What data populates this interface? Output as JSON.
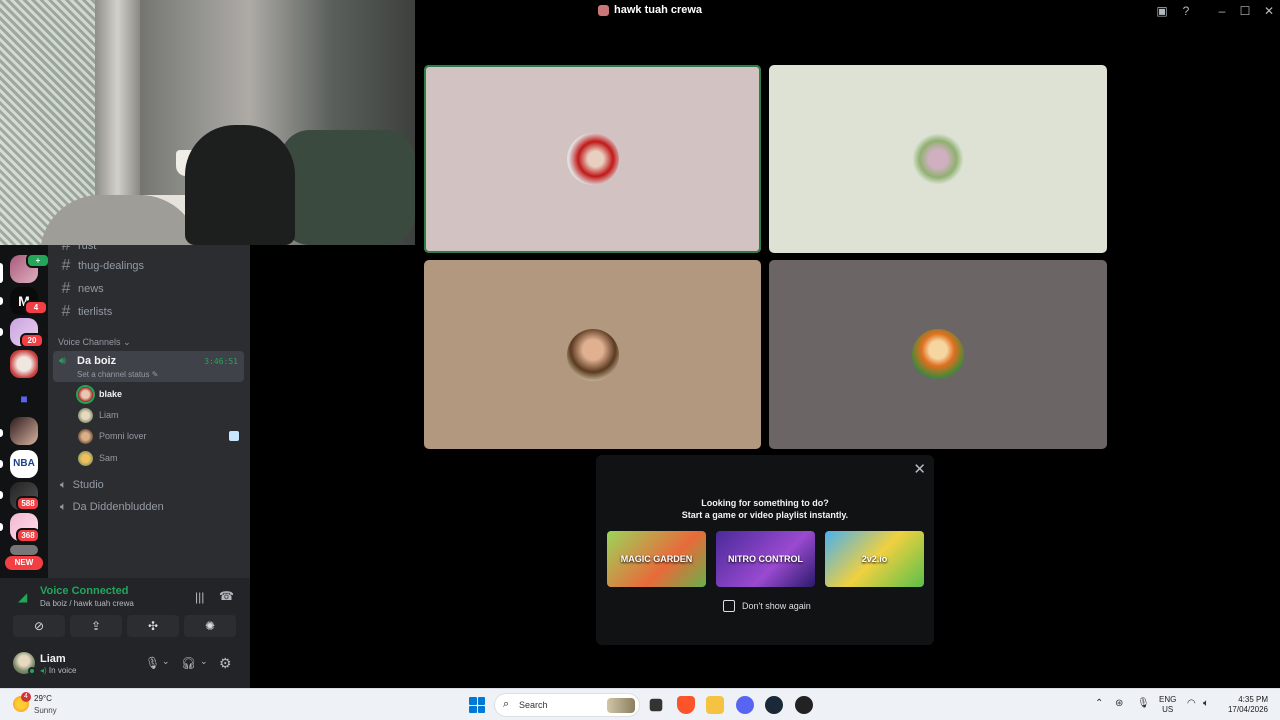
{
  "window": {
    "title": "hawk tuah crewa"
  },
  "servers": [
    {
      "name": "server-1",
      "badge": ""
    },
    {
      "name": "server-2",
      "badge": "4"
    },
    {
      "name": "server-3",
      "badge": "20"
    },
    {
      "name": "server-4",
      "badge": ""
    },
    {
      "name": "folder",
      "badge": ""
    },
    {
      "name": "server-6",
      "badge": ""
    },
    {
      "name": "nba",
      "badge": "NBA"
    },
    {
      "name": "server-8",
      "badge": "588"
    },
    {
      "name": "server-9",
      "badge": "368"
    }
  ],
  "new_badge": "NEW",
  "text_channels": [
    "rust",
    "thug-dealings",
    "news",
    "tierlists"
  ],
  "voice_section_label": "Voice Channels",
  "active_voice": {
    "name": "Da boiz",
    "timer": "3:46:51",
    "status_placeholder": "Set a channel status"
  },
  "members": [
    {
      "name": "blake",
      "speaking": true
    },
    {
      "name": "Liam",
      "speaking": false
    },
    {
      "name": "Pomni lover",
      "speaking": false
    },
    {
      "name": "Sam",
      "speaking": false
    }
  ],
  "other_voice": [
    "Studio",
    "Da Diddenbludden"
  ],
  "voice_panel": {
    "status": "Voice Connected",
    "location": "Da boiz / hawk tuah crewa"
  },
  "user": {
    "name": "Liam",
    "status": "In voice"
  },
  "popup": {
    "line1": "Looking for something to do?",
    "line2": "Start a game or video playlist instantly.",
    "activities": [
      "MAGIC GARDEN",
      "NITRO CONTROL",
      "2v2.io"
    ],
    "checkbox_label": "Don't show again"
  },
  "taskbar": {
    "temp": "29°C",
    "condition": "Sunny",
    "weather_badge": "4",
    "search_placeholder": "Search",
    "lang_top": "ENG",
    "lang_bottom": "US",
    "time": "4:35 PM",
    "date": "17/04/2026"
  },
  "colors": {
    "green": "#23a55a",
    "tile1": "#d2c2c2",
    "tile2": "#dde2d4",
    "tile3": "#b39880",
    "tile4": "#6c6565"
  }
}
